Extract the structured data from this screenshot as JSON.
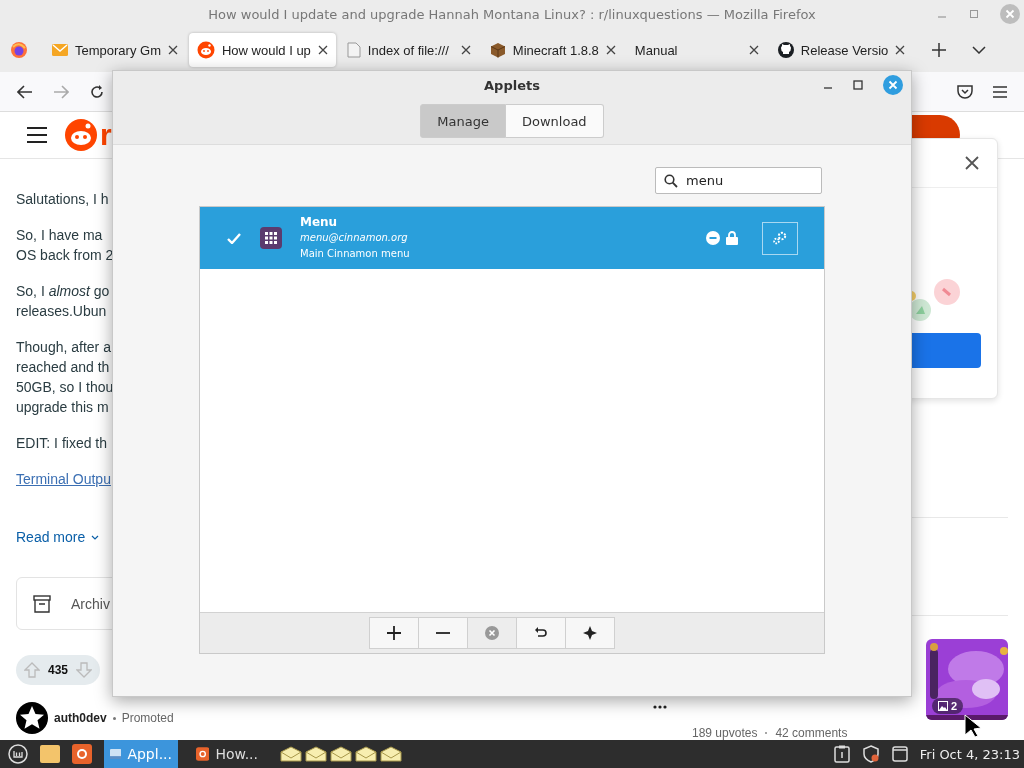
{
  "window": {
    "title": "How would I update and upgrade Hannah Montana Linux? : r/linuxquestions — Mozilla Firefox"
  },
  "tabs": [
    {
      "label": "Temporary Gm",
      "kind": "mail",
      "selected": false
    },
    {
      "label": "How would I up",
      "kind": "reddit",
      "selected": true
    },
    {
      "label": "Index of file:///",
      "kind": "file",
      "selected": false
    },
    {
      "label": "Minecraft 1.8.8",
      "kind": "block",
      "selected": false
    },
    {
      "label": "Manual",
      "kind": "plain",
      "selected": false
    },
    {
      "label": "Release Versio",
      "kind": "github",
      "selected": false
    }
  ],
  "page": {
    "logo_text": "r",
    "paragraphs": [
      {
        "kind": "text",
        "lines": [
          "Salutations, I h"
        ]
      },
      {
        "kind": "text",
        "lines": [
          "So, I have ma",
          "OS back from 2"
        ]
      },
      {
        "kind": "text",
        "lines": [
          "So, I *almost* go",
          "releases.Ubun"
        ]
      },
      {
        "kind": "text",
        "lines": [
          "Though, after a",
          "reached and th",
          "50GB, so I thou",
          "upgrade this m"
        ]
      },
      {
        "kind": "text",
        "lines": [
          "EDIT: I fixed th"
        ]
      },
      {
        "kind": "link",
        "lines": [
          "Terminal Outpu"
        ]
      }
    ],
    "read_more": "Read more",
    "archive": "Archiv",
    "votes": "435",
    "author": "auth0dev",
    "promoted": "Promoted",
    "related": {
      "upvotes": "189 upvotes",
      "comments": "42 comments",
      "image_count": "2"
    }
  },
  "dialog": {
    "title": "Applets",
    "tabs": [
      {
        "label": "Manage",
        "selected": true
      },
      {
        "label": "Download",
        "selected": false
      }
    ],
    "search": {
      "value": "menu"
    },
    "applets": [
      {
        "name": "Menu",
        "uuid": "menu@cinnamon.org",
        "description": "Main Cinnamon menu",
        "enabled": true,
        "selected": true,
        "locked": true
      }
    ],
    "toolbar": [
      {
        "kind": "add",
        "disabled": false
      },
      {
        "kind": "remove",
        "disabled": false
      },
      {
        "kind": "clear",
        "disabled": true
      },
      {
        "kind": "undo",
        "disabled": false
      },
      {
        "kind": "spark",
        "disabled": false
      }
    ]
  },
  "taskbar": {
    "apps": [
      {
        "label": "Appl...",
        "kind": "applets",
        "selected": true
      },
      {
        "label": "How...",
        "kind": "firefox",
        "selected": false
      }
    ],
    "clock": "Fri Oct 4, 23:13"
  }
}
